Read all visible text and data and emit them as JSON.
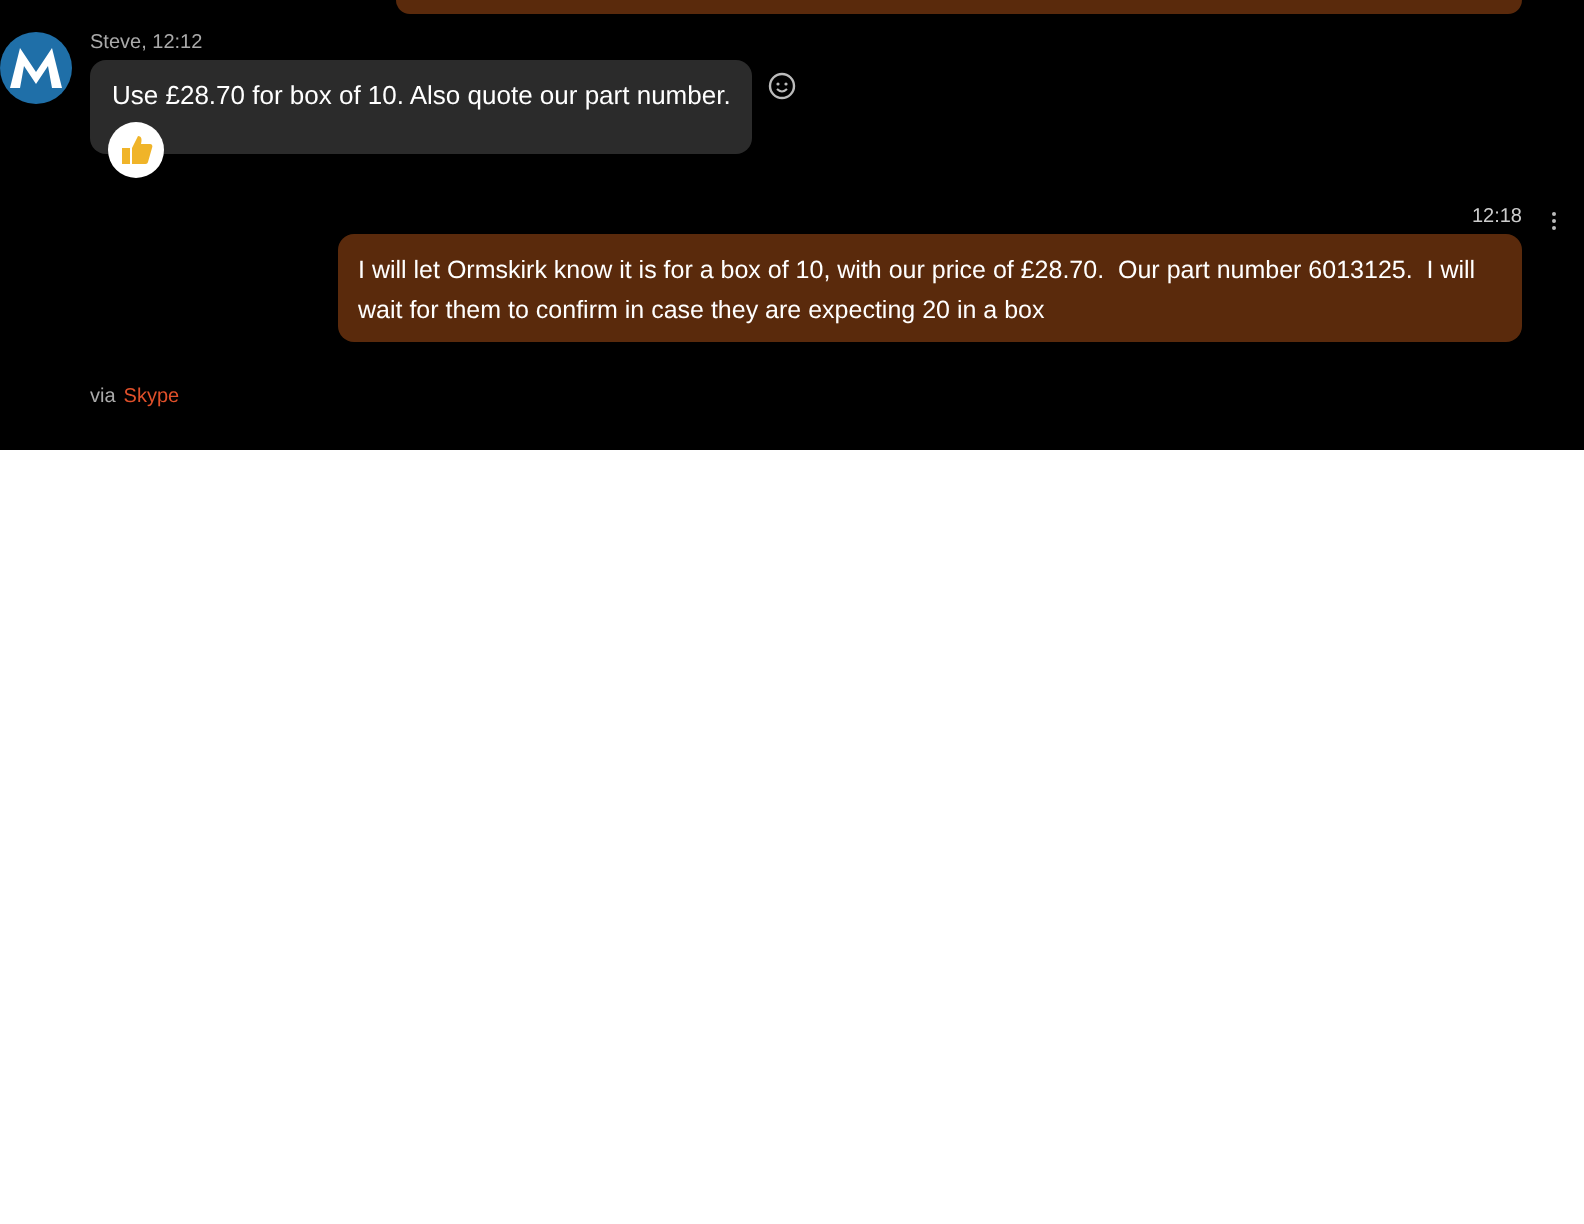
{
  "messages": [
    {
      "kind": "incoming",
      "sender": "Steve, 12:12",
      "text": "Use £28.70 for box of 10. Also quote our part number.",
      "reacted": true
    },
    {
      "kind": "outgoing",
      "time": "12:18",
      "text": "I will let Ormskirk know it is for a box of 10, with our price of £28.70.  Our part number 6013125.  I will wait for them to confirm in case they are expecting 20 in a box"
    }
  ],
  "footer": {
    "prefix": "via",
    "link": "Skype"
  }
}
